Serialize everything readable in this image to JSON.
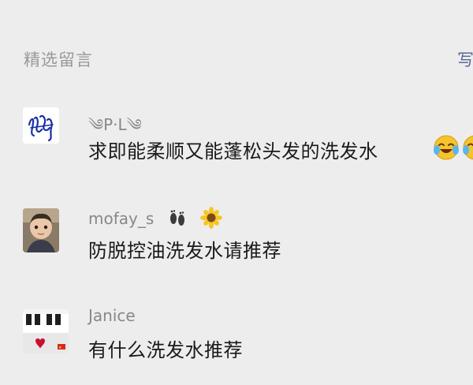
{
  "header": {
    "section_title": "精选留言",
    "write_label": "写"
  },
  "comments": [
    {
      "nickname": "༄P·L༄",
      "content": "求即能柔顺又能蓬松头发的洗发水",
      "trailing_emojis": [
        "laughing-crying-face-icon",
        "laughing-crying-face-icon"
      ]
    },
    {
      "nickname": "mofay_s",
      "nickname_emojis": [
        "footprints-icon",
        "sunflower-icon"
      ],
      "content": "防脱控油洗发水请推荐"
    },
    {
      "nickname": "Janice",
      "content": "有什么洗发水推荐"
    }
  ],
  "colors": {
    "background": "#ededed",
    "meta_text": "#888888",
    "body_text": "#1a1a1a",
    "link": "#576b95"
  }
}
